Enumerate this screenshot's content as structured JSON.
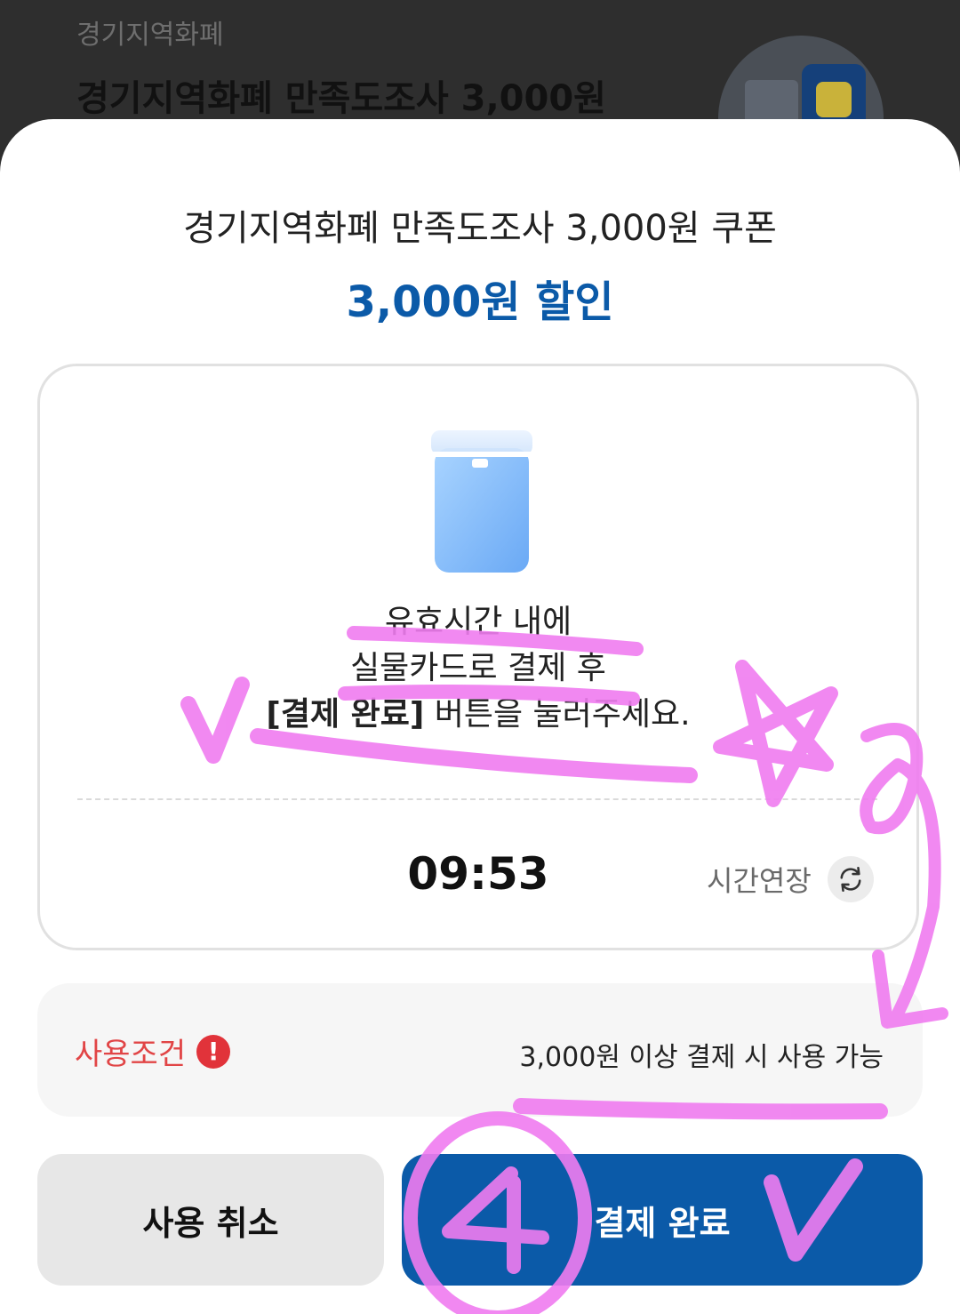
{
  "background": {
    "category": "경기지역화폐",
    "title": "경기지역화폐 만족도조사 3,000원"
  },
  "sheet": {
    "title": "경기지역화폐 만족도조사 3,000원 쿠폰",
    "discount": "3,000원 할인",
    "instruction": {
      "line1": "유효시간 내에",
      "line2": "실물카드로 결제 후",
      "line3_bold": "[결제 완료]",
      "line3_rest": " 버튼을 눌러주세요."
    },
    "timer": "09:53",
    "extend_label": "시간연장",
    "condition": {
      "label": "사용조건",
      "alert_glyph": "!",
      "text": "3,000원 이상 결제 시 사용 가능"
    },
    "buttons": {
      "cancel": "사용 취소",
      "complete": "결제 완료"
    }
  },
  "colors": {
    "accent": "#0b5aa8",
    "warning": "#e14546",
    "annotation": "#f07cf0"
  },
  "icons": {
    "card": "card-icon",
    "refresh": "refresh-icon",
    "alert": "alert-icon"
  },
  "annotation_marks": [
    "✓",
    "★",
    "2",
    "4",
    "✓"
  ]
}
